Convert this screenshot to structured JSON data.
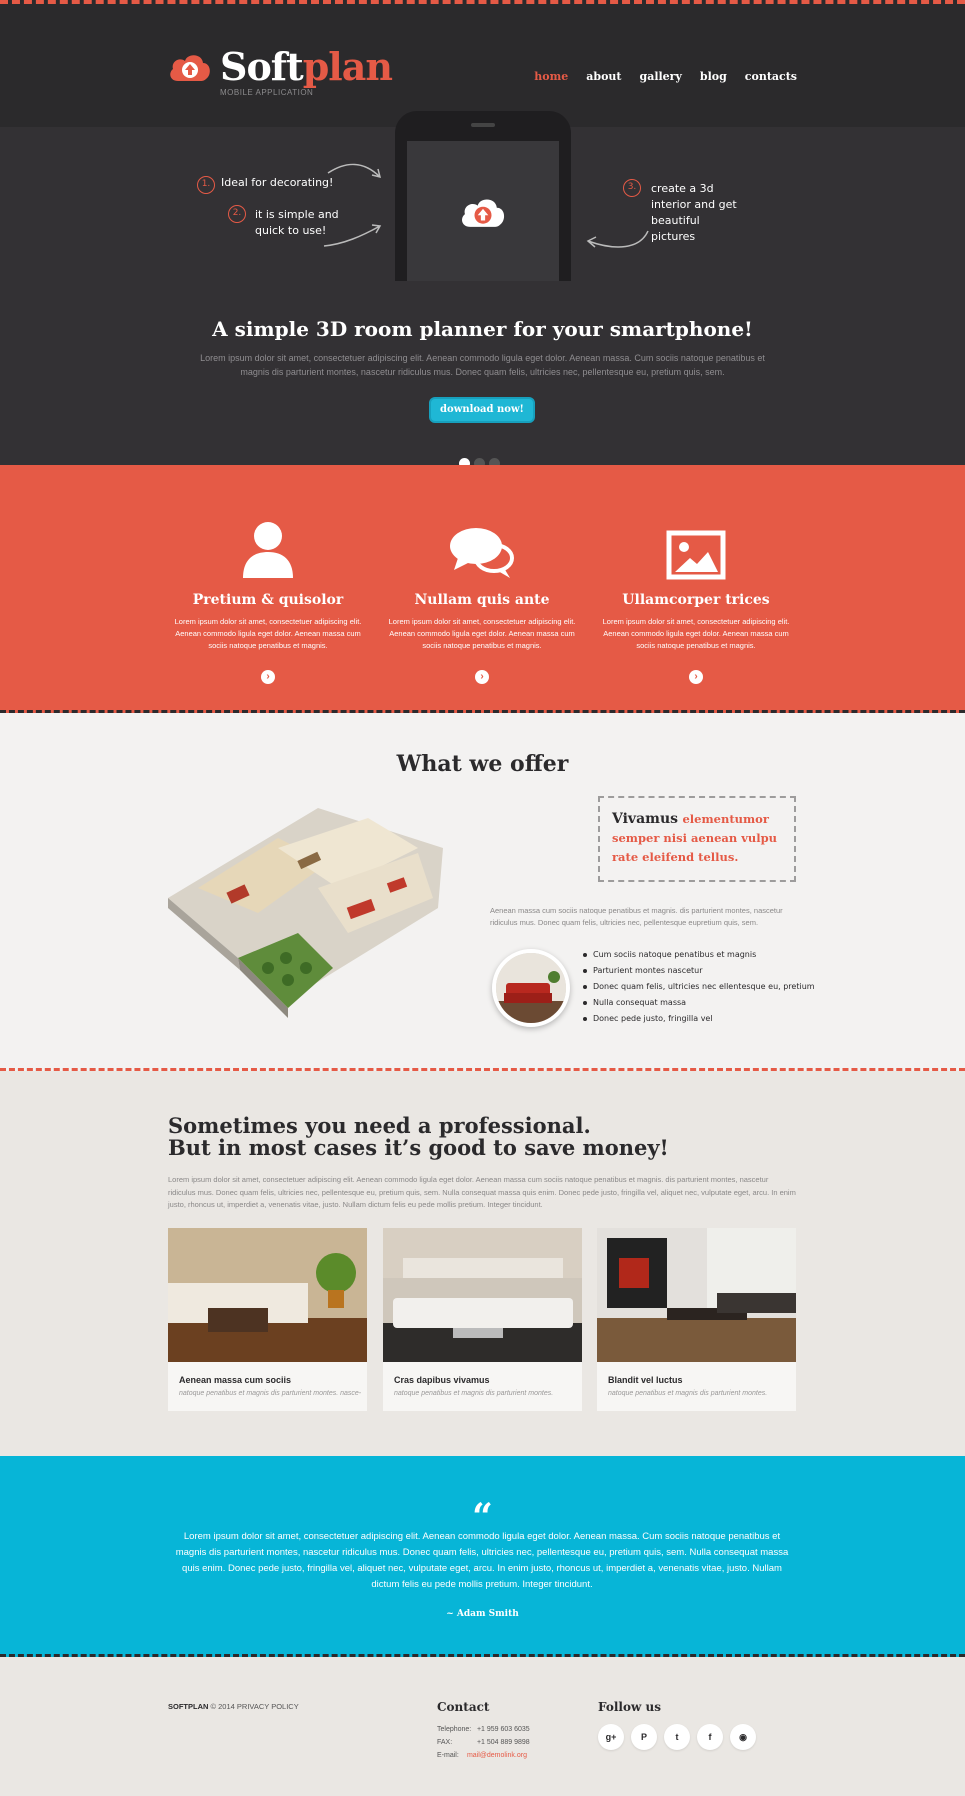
{
  "brand": {
    "name_part1": "Soft",
    "name_part2": "plan",
    "tagline": "MOBILE APPLICATION"
  },
  "nav": [
    {
      "label": "home",
      "active": true
    },
    {
      "label": "about"
    },
    {
      "label": "gallery"
    },
    {
      "label": "blog"
    },
    {
      "label": "contacts"
    }
  ],
  "hero": {
    "notes": [
      {
        "num": "1.",
        "text": "Ideal for decorating!"
      },
      {
        "num": "2.",
        "text": "it is simple and quick to use!"
      },
      {
        "num": "3.",
        "text": "create a 3d interior and get beautiful pictures"
      }
    ],
    "title": "A simple 3D room planner for your smartphone!",
    "text": "Lorem ipsum dolor sit amet, consectetuer adipiscing elit. Aenean commodo ligula eget dolor. Aenean massa. Cum sociis natoque penatibus et magnis dis parturient montes, nascetur ridiculus mus. Donec quam felis, ultricies nec, pellentesque eu, pretium quis, sem.",
    "button": "download now!",
    "slides": 3,
    "active_slide": 1
  },
  "features": [
    {
      "icon": "user-icon",
      "title": "Pretium & quisolor",
      "text": "Lorem ipsum dolor sit amet, consectetuer adipiscing elit. Aenean commodo ligula eget dolor. Aenean massa cum sociis natoque penatibus et magnis."
    },
    {
      "icon": "chat-icon",
      "title": "Nullam quis ante",
      "text": "Lorem ipsum dolor sit amet, consectetuer adipiscing elit. Aenean commodo ligula eget dolor. Aenean massa cum sociis natoque penatibus et magnis."
    },
    {
      "icon": "image-icon",
      "title": "Ullamcorper trices",
      "text": "Lorem ipsum dolor sit amet, consectetuer adipiscing elit. Aenean commodo ligula eget dolor. Aenean massa cum sociis natoque penatibus et magnis."
    }
  ],
  "offer": {
    "title": "What we offer",
    "quote_dark": "Vivamus",
    "quote_red": "elementumor semper nisi aenean vulpu rate eleifend tellus.",
    "text": "Aenean massa cum sociis natoque penatibus et magnis. dis parturient montes, nascetur ridiculus mus. Donec quam felis, ultricies nec, pellentesque eupretium quis, sem.",
    "bullets": [
      "Cum sociis natoque penatibus et magnis",
      "Parturient montes nascetur",
      "Donec quam felis, ultricies nec ellentesque eu, pretium",
      "Nulla consequat massa",
      "Donec pede justo, fringilla vel"
    ]
  },
  "pro": {
    "title_line1": "Sometimes you need a professional.",
    "title_line2": "But in most cases it’s good to save money!",
    "text": "Lorem ipsum dolor sit amet, consectetuer adipiscing elit. Aenean commodo ligula eget dolor. Aenean massa cum sociis natoque penatibus et magnis. dis parturient montes, nascetur ridiculus mus. Donec quam felis, ultricies nec, pellentesque eu, pretium quis, sem. Nulla consequat massa quis enim. Donec pede justo, fringilla vel, aliquet nec, vulputate eget, arcu. In enim justo, rhoncus ut, imperdiet a, venenatis vitae, justo. Nullam dictum felis eu pede mollis pretium. Integer tincidunt.",
    "cards": [
      {
        "title": "Aenean massa cum sociis",
        "text": "natoque penatibus et magnis dis parturient montes. nasce-"
      },
      {
        "title": "Cras dapibus vivamus",
        "text": "natoque penatibus et magnis dis parturient montes."
      },
      {
        "title": "Blandit vel luctus",
        "text": "natoque penatibus et magnis dis parturient montes."
      }
    ]
  },
  "testimonial": {
    "quote_mark": "“",
    "text": "Lorem ipsum dolor sit amet, consectetuer adipiscing elit. Aenean commodo ligula eget dolor. Aenean massa. Cum sociis natoque penatibus et magnis dis parturient montes, nascetur ridiculus mus. Donec quam felis, ultricies nec, pellentesque eu, pretium quis, sem. Nulla consequat massa quis enim. Donec pede justo, fringilla vel, aliquet nec, vulputate eget, arcu. In enim justo, rhoncus ut, imperdiet a, venenatis vitae, justo. Nullam dictum felis eu pede mollis pretium. Integer tincidunt.",
    "author": "~ Adam Smith"
  },
  "footer": {
    "brand": "SOFTPLAN",
    "copyright": "© 2014 PRIVACY POLICY",
    "contact_title": "Contact",
    "phone_label": "Telephone:",
    "phone": "+1 959 603 6035",
    "fax_label": "FAX:",
    "fax": "+1 504 889 9898",
    "email_label": "E-mail:",
    "email": "mail@demolink.org",
    "follow_title": "Follow us",
    "socials": [
      {
        "name": "google-plus-icon",
        "glyph": "g+"
      },
      {
        "name": "pinterest-icon",
        "glyph": "P"
      },
      {
        "name": "twitter-icon",
        "glyph": "t"
      },
      {
        "name": "facebook-icon",
        "glyph": "f"
      },
      {
        "name": "rss-icon",
        "glyph": "◉"
      }
    ]
  },
  "colors": {
    "accent": "#e55a46",
    "dark": "#2b2a2c",
    "cyan": "#07b5d7"
  }
}
